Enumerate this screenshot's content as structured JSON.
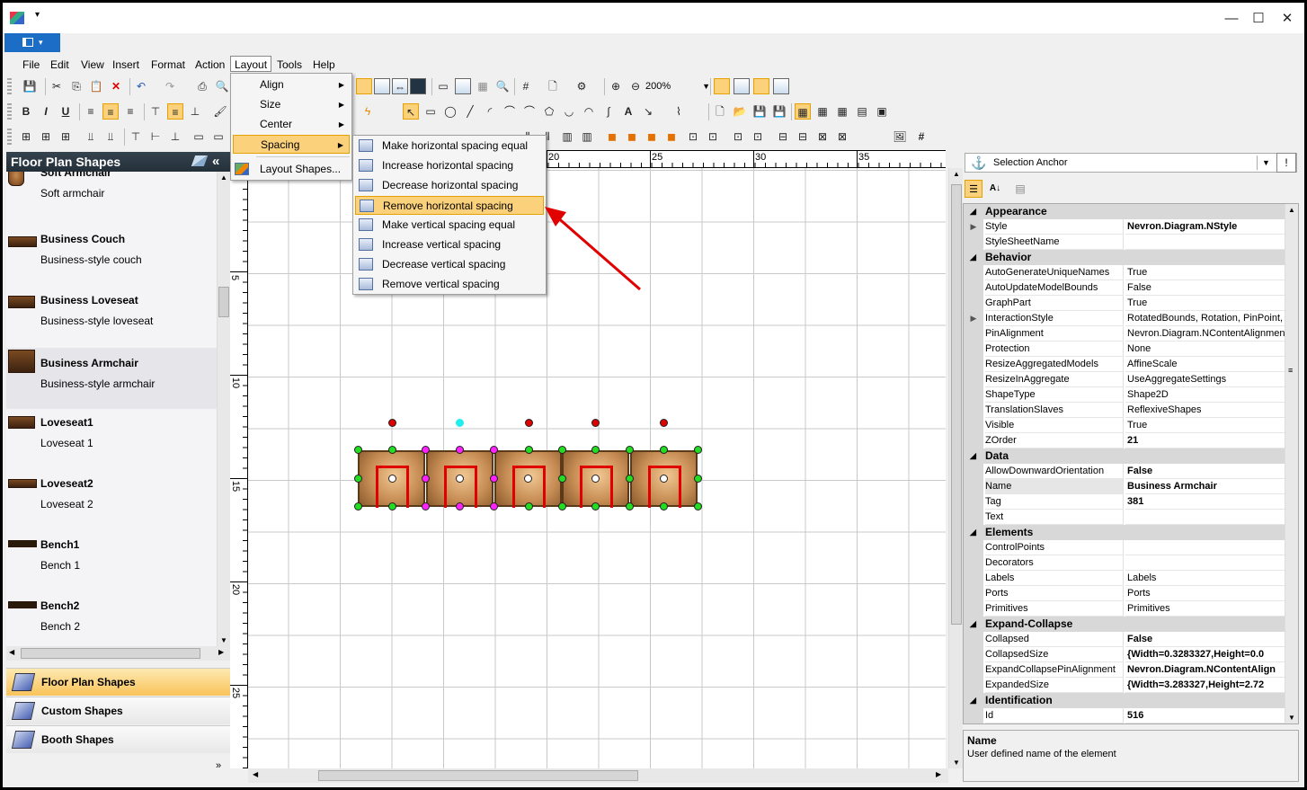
{
  "menubar": {
    "items": [
      "File",
      "Edit",
      "View",
      "Insert",
      "Format",
      "Action",
      "Layout",
      "Tools",
      "Help"
    ]
  },
  "toolbar": {
    "zoom": "200%",
    "grid_symbol": "#"
  },
  "layout_menu": {
    "items": [
      {
        "label": "Align",
        "has_submenu": true
      },
      {
        "label": "Size",
        "has_submenu": true
      },
      {
        "label": "Center",
        "has_submenu": true
      },
      {
        "label": "Spacing",
        "has_submenu": true
      },
      {
        "label": "Layout Shapes...",
        "has_submenu": false
      }
    ]
  },
  "spacing_menu": {
    "items": [
      "Make horizontal spacing equal",
      "Increase horizontal spacing",
      "Decrease horizontal spacing",
      "Remove horizontal spacing",
      "Make vertical spacing equal",
      "Increase vertical spacing",
      "Decrease vertical spacing",
      "Remove vertical spacing"
    ],
    "highlighted": "Remove horizontal spacing"
  },
  "left_panel": {
    "title": "Floor Plan Shapes",
    "collapse_symbol": "«",
    "shapes": [
      {
        "title": "Soft Armchair",
        "desc": "Soft armchair"
      },
      {
        "title": "Business Couch",
        "desc": "Business-style couch"
      },
      {
        "title": "Business Loveseat",
        "desc": "Business-style loveseat"
      },
      {
        "title": "Business Armchair",
        "desc": "Business-style armchair"
      },
      {
        "title": "Loveseat1",
        "desc": "Loveseat 1"
      },
      {
        "title": "Loveseat2",
        "desc": "Loveseat 2"
      },
      {
        "title": "Bench1",
        "desc": "Bench 1"
      },
      {
        "title": "Bench2",
        "desc": "Bench 2"
      }
    ],
    "categories": [
      "Floor Plan Shapes",
      "Custom Shapes",
      "Booth Shapes"
    ]
  },
  "rulers": {
    "top": [
      "20",
      "25",
      "30",
      "35"
    ],
    "left": [
      "5",
      "10",
      "15",
      "20",
      "25"
    ]
  },
  "property_grid": {
    "selected_object": "Selection Anchor",
    "rows": [
      {
        "cat": "Appearance"
      },
      {
        "name": "Style",
        "value": "Nevron.Diagram.NStyle",
        "bold": true,
        "expand": true
      },
      {
        "name": "StyleSheetName",
        "value": ""
      },
      {
        "cat": "Behavior"
      },
      {
        "name": "AutoGenerateUniqueNames",
        "value": "True"
      },
      {
        "name": "AutoUpdateModelBounds",
        "value": "False"
      },
      {
        "name": "GraphPart",
        "value": "True"
      },
      {
        "name": "InteractionStyle",
        "value": "RotatedBounds, Rotation, PinPoint, S",
        "expand": true
      },
      {
        "name": "PinAlignment",
        "value": "Nevron.Diagram.NContentAlignment"
      },
      {
        "name": "Protection",
        "value": "None"
      },
      {
        "name": "ResizeAggregatedModels",
        "value": "AffineScale"
      },
      {
        "name": "ResizeInAggregate",
        "value": "UseAggregateSettings"
      },
      {
        "name": "ShapeType",
        "value": "Shape2D"
      },
      {
        "name": "TranslationSlaves",
        "value": "ReflexiveShapes"
      },
      {
        "name": "Visible",
        "value": "True"
      },
      {
        "name": "ZOrder",
        "value": "21",
        "bold": true
      },
      {
        "cat": "Data"
      },
      {
        "name": "AllowDownwardOrientation",
        "value": "False",
        "bold": true
      },
      {
        "name": "Name",
        "value": "Business Armchair",
        "bold": true
      },
      {
        "name": "Tag",
        "value": "381",
        "bold": true
      },
      {
        "name": "Text",
        "value": ""
      },
      {
        "cat": "Elements"
      },
      {
        "name": "ControlPoints",
        "value": ""
      },
      {
        "name": "Decorators",
        "value": ""
      },
      {
        "name": "Labels",
        "value": "Labels"
      },
      {
        "name": "Ports",
        "value": "Ports"
      },
      {
        "name": "Primitives",
        "value": "Primitives"
      },
      {
        "cat": "Expand-Collapse"
      },
      {
        "name": "Collapsed",
        "value": "False",
        "bold": true
      },
      {
        "name": "CollapsedSize",
        "value": "{Width=0.3283327,Height=0.0",
        "bold": true
      },
      {
        "name": "ExpandCollapsePinAlignment",
        "value": "Nevron.Diagram.NContentAlign",
        "bold": true
      },
      {
        "name": "ExpandedSize",
        "value": "{Width=3.283327,Height=2.72",
        "bold": true
      },
      {
        "cat": "Identification"
      },
      {
        "name": "Id",
        "value": "516",
        "bold": true
      }
    ],
    "description_title": "Name",
    "description_text": "User defined name of the element"
  },
  "colors": {
    "accent_blue": "#1c6dc5",
    "menu_highlight": "#fbd27b",
    "annotation_arrow": "#e00000"
  }
}
